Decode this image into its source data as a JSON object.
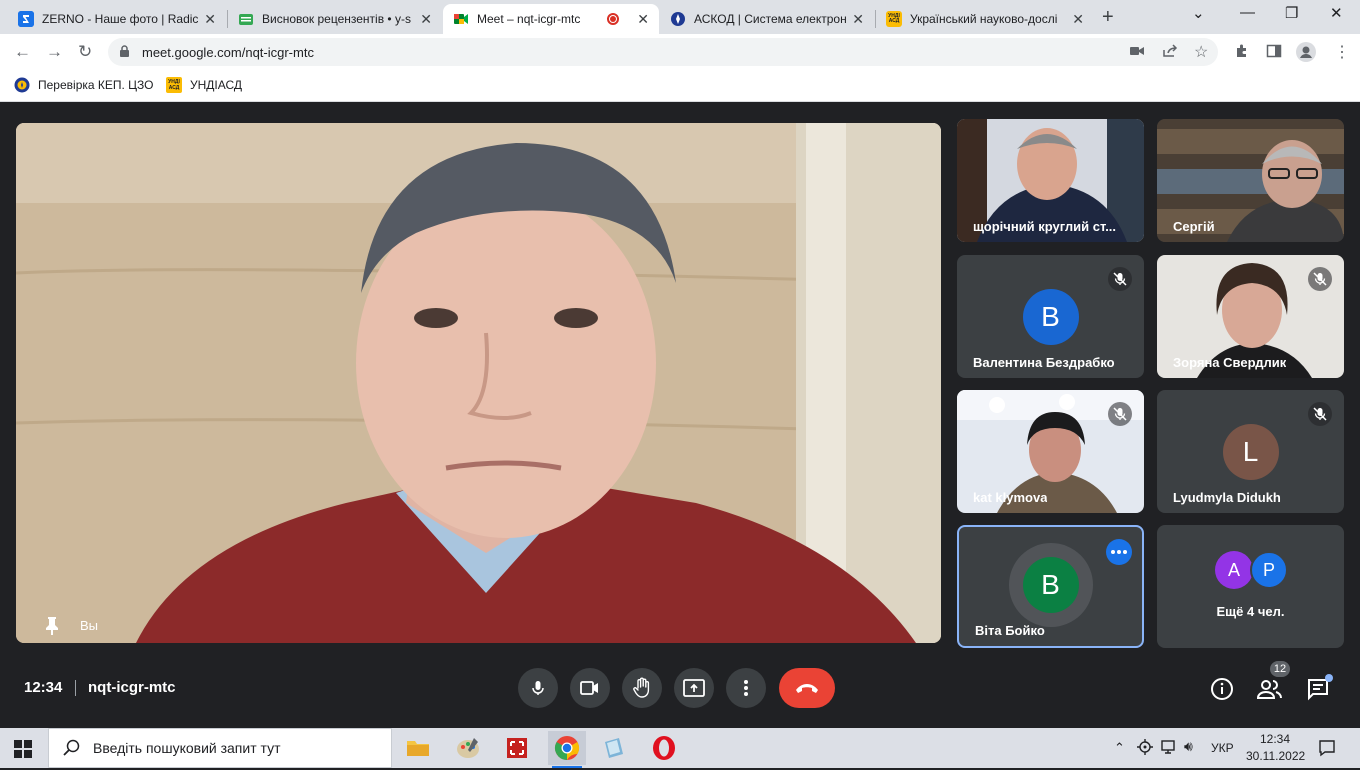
{
  "browser": {
    "tabs": [
      {
        "title": "ZERNO - Наше фото | Radic",
        "favicon": "Z",
        "color": "#1a73e8"
      },
      {
        "title": "Висновок рецензентів • у-s",
        "favicon": "",
        "color": "#34a853"
      },
      {
        "title": "Meet – nqt-icgr-mtc",
        "favicon": "",
        "color": "#00832d",
        "active": true,
        "recording": true
      },
      {
        "title": "АСКОД | Система електрон",
        "favicon": "",
        "color": "#1f3a93"
      },
      {
        "title": "Український науково-дослі",
        "favicon": "УНДІ АСД",
        "color": "#fbbc04"
      }
    ],
    "url": "meet.google.com/nqt-icgr-mtc",
    "bookmarks": [
      {
        "label": "Перевірка КЕП. ЦЗО",
        "icon": "seal-icon"
      },
      {
        "label": "УНДІАСД",
        "icon": "undiasd-logo",
        "logo_text": "УНДІ АСД"
      }
    ]
  },
  "meet": {
    "main": {
      "label": "Вы"
    },
    "tiles": [
      {
        "name": "щорічний круглий ст...",
        "type": "video",
        "muted": false
      },
      {
        "name": "Сергій",
        "type": "video",
        "muted": false
      },
      {
        "name": "Валентина Бездрабко",
        "type": "avatar",
        "initial": "B",
        "color": "#1967d2",
        "muted": true
      },
      {
        "name": "Зоряна Свердлик",
        "type": "video",
        "muted": true
      },
      {
        "name": "kat klymova",
        "type": "video",
        "muted": true
      },
      {
        "name": "Lyudmyla Didukh",
        "type": "avatar",
        "initial": "L",
        "color": "#795548",
        "muted": true
      },
      {
        "name": "Віта Бойко",
        "type": "avatar",
        "initial": "B",
        "color": "#0b8043",
        "muted": false,
        "selected": true
      }
    ],
    "more": {
      "label": "Ещё 4 чел.",
      "avatars": [
        {
          "initial": "A",
          "color": "#9334e6"
        },
        {
          "initial": "P",
          "color": "#1a73e8"
        }
      ]
    },
    "time": "12:34",
    "code": "nqt-icgr-mtc",
    "participants_count": "12"
  },
  "taskbar": {
    "search_placeholder": "Введіть пошуковий запит тут",
    "lang": "УКР",
    "clock_time": "12:34",
    "clock_date": "30.11.2022"
  }
}
